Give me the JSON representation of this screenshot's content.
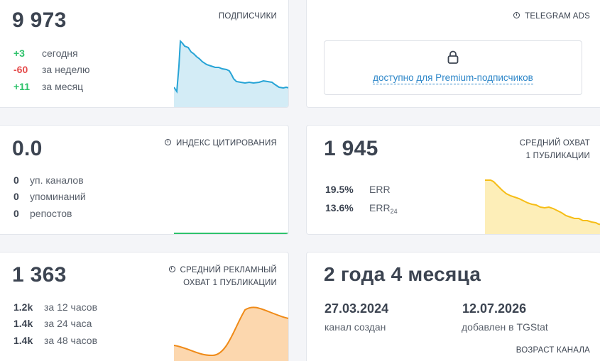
{
  "subscribers": {
    "title": "ПОДПИСЧИКИ",
    "value": "9 973",
    "rows": [
      {
        "value": "+3",
        "label": "сегодня",
        "trend": "up"
      },
      {
        "value": "-60",
        "label": "за неделю",
        "trend": "down"
      },
      {
        "value": "+11",
        "label": "за месяц",
        "trend": "up"
      }
    ]
  },
  "ads": {
    "title": "TELEGRAM ADS",
    "locked_text": "доступно для Premium-подписчиков",
    "icon": "lock-icon"
  },
  "citation": {
    "title": "ИНДЕКС ЦИТИРОВАНИЯ",
    "value": "0.0",
    "rows": [
      {
        "value": "0",
        "label": "уп. каналов"
      },
      {
        "value": "0",
        "label": "упоминаний"
      },
      {
        "value": "0",
        "label": "репостов"
      }
    ]
  },
  "reach": {
    "title_line1": "СРЕДНИЙ ОХВАТ",
    "title_line2": "1 ПУБЛИКАЦИИ",
    "value": "1 945",
    "rows": [
      {
        "value": "19.5%",
        "label": "ERR",
        "sub": ""
      },
      {
        "value": "13.6%",
        "label": "ERR",
        "sub": "24"
      }
    ]
  },
  "ad_reach": {
    "title_line1": "СРЕДНИЙ РЕКЛАМНЫЙ",
    "title_line2": "ОХВАТ 1 ПУБЛИКАЦИИ",
    "value": "1 363",
    "rows": [
      {
        "value": "1.2k",
        "label": "за 12 часов"
      },
      {
        "value": "1.4k",
        "label": "за 24 часа"
      },
      {
        "value": "1.4k",
        "label": "за 48 часов"
      }
    ]
  },
  "age": {
    "value": "2 года 4 месяца",
    "created_date": "27.03.2024",
    "created_label": "канал создан",
    "added_date": "12.07.2026",
    "added_label": "добавлен в TGStat",
    "footer": "ВОЗРАСТ КАНАЛА"
  },
  "colors": {
    "blue_line": "#27a4d6",
    "blue_fill": "#d3ecf6",
    "green_line": "#2ec26b",
    "yellow_line": "#f6bd16",
    "yellow_fill": "#fdeeb8",
    "orange_line": "#ef8a17",
    "orange_fill": "#fcd7ae"
  }
}
